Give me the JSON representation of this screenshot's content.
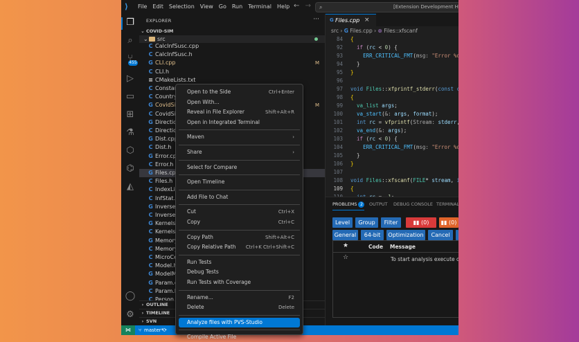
{
  "titlebar": {
    "menu": [
      "File",
      "Edit",
      "Selection",
      "View",
      "Go",
      "Run",
      "Terminal",
      "Help"
    ],
    "command_center": "[Extension Development Host] c"
  },
  "activity": {
    "badge": "455"
  },
  "explorer": {
    "title": "EXPLORER",
    "root": "COVID-SIM",
    "folder": "src",
    "files": [
      {
        "icon": "C",
        "cls": "c",
        "name": "CalcInfSusc.cpp",
        "status": "",
        "mod": false
      },
      {
        "icon": "C",
        "cls": "c",
        "name": "CalcInfSusc.h",
        "status": "",
        "mod": false
      },
      {
        "icon": "G",
        "cls": "cp",
        "name": "CLI.cpp",
        "status": "M",
        "mod": true
      },
      {
        "icon": "C",
        "cls": "c",
        "name": "CLI.h",
        "status": "",
        "mod": false
      },
      {
        "icon": "≡",
        "cls": "tx",
        "name": "CMakeLists.txt",
        "status": "",
        "mod": false
      },
      {
        "icon": "C",
        "cls": "c",
        "name": "Constant",
        "status": "",
        "mod": false
      },
      {
        "icon": "C",
        "cls": "c",
        "name": "Country.",
        "status": "",
        "mod": false
      },
      {
        "icon": "G",
        "cls": "cp",
        "name": "CovidSim",
        "status": "M",
        "mod": true
      },
      {
        "icon": "C",
        "cls": "c",
        "name": "CovidSim",
        "status": "",
        "mod": false
      },
      {
        "icon": "G",
        "cls": "cp",
        "name": "Direction",
        "status": "",
        "mod": false
      },
      {
        "icon": "C",
        "cls": "c",
        "name": "Direction",
        "status": "",
        "mod": false
      },
      {
        "icon": "G",
        "cls": "cp",
        "name": "Dist.cpp",
        "status": "",
        "mod": false
      },
      {
        "icon": "C",
        "cls": "c",
        "name": "Dist.h",
        "status": "",
        "mod": false
      },
      {
        "icon": "G",
        "cls": "cp",
        "name": "Error.cpp",
        "status": "",
        "mod": false
      },
      {
        "icon": "C",
        "cls": "c",
        "name": "Error.h",
        "status": "",
        "mod": false
      },
      {
        "icon": "G",
        "cls": "cp",
        "name": "Files.cpp",
        "status": "",
        "mod": false
      },
      {
        "icon": "C",
        "cls": "c",
        "name": "Files.h",
        "status": "",
        "mod": false
      },
      {
        "icon": "C",
        "cls": "c",
        "name": "IndexList",
        "status": "",
        "mod": false
      },
      {
        "icon": "C",
        "cls": "c",
        "name": "InfStat.h",
        "status": "",
        "mod": false
      },
      {
        "icon": "G",
        "cls": "cp",
        "name": "InverseC",
        "status": "",
        "mod": false
      },
      {
        "icon": "C",
        "cls": "c",
        "name": "InverseC",
        "status": "",
        "mod": false
      },
      {
        "icon": "G",
        "cls": "cp",
        "name": "Kernels.c",
        "status": "",
        "mod": false
      },
      {
        "icon": "C",
        "cls": "c",
        "name": "Kernels.h",
        "status": "",
        "mod": false
      },
      {
        "icon": "G",
        "cls": "cp",
        "name": "Memory.",
        "status": "",
        "mod": false
      },
      {
        "icon": "C",
        "cls": "c",
        "name": "Memory.",
        "status": "",
        "mod": false
      },
      {
        "icon": "C",
        "cls": "c",
        "name": "MicroCel",
        "status": "",
        "mod": false
      },
      {
        "icon": "C",
        "cls": "c",
        "name": "Model.h",
        "status": "",
        "mod": false
      },
      {
        "icon": "G",
        "cls": "cp",
        "name": "ModelM",
        "status": "",
        "mod": false
      },
      {
        "icon": "G",
        "cls": "cp",
        "name": "Param.cp",
        "status": "",
        "mod": false
      },
      {
        "icon": "C",
        "cls": "c",
        "name": "Param.h",
        "status": "",
        "mod": false
      },
      {
        "icon": "C",
        "cls": "c",
        "name": "Person.c",
        "status": "",
        "mod": false
      }
    ],
    "sections": [
      "OUTLINE",
      "TIMELINE",
      "SVN"
    ]
  },
  "editor": {
    "tab": "Files.cpp",
    "breadcrumb": [
      "src",
      "Files.cpp",
      "Files::xfscanf"
    ]
  },
  "panel": {
    "tabs": [
      "PROBLEMS",
      "OUTPUT",
      "DEBUG CONSOLE",
      "TERMINAL"
    ],
    "problems_count": "2",
    "buttons_row1": [
      "Level",
      "Group",
      "Filter"
    ],
    "count1": "(0)",
    "count2": "(0)",
    "buttons_row2": [
      "General",
      "64-bit",
      "Optimization",
      "Cancel"
    ],
    "table_headers": [
      "Code",
      "Message"
    ],
    "empty_message": "To start analysis execute one c"
  },
  "status": {
    "branch": "master*"
  },
  "context_menu": {
    "groups": [
      [
        {
          "label": "Open to the Side",
          "key": "Ctrl+Enter"
        },
        {
          "label": "Open With...",
          "key": ""
        },
        {
          "label": "Reveal in File Explorer",
          "key": "Shift+Alt+R"
        },
        {
          "label": "Open in Integrated Terminal",
          "key": ""
        }
      ],
      [
        {
          "label": "Maven",
          "key": "›"
        }
      ],
      [
        {
          "label": "Share",
          "key": "›"
        }
      ],
      [
        {
          "label": "Select for Compare",
          "key": ""
        }
      ],
      [
        {
          "label": "Open Timeline",
          "key": ""
        }
      ],
      [
        {
          "label": "Add File to Chat",
          "key": ""
        }
      ],
      [
        {
          "label": "Cut",
          "key": "Ctrl+X"
        },
        {
          "label": "Copy",
          "key": "Ctrl+C"
        }
      ],
      [
        {
          "label": "Copy Path",
          "key": "Shift+Alt+C"
        },
        {
          "label": "Copy Relative Path",
          "key": "Ctrl+K Ctrl+Shift+C"
        }
      ],
      [
        {
          "label": "Run Tests",
          "key": ""
        },
        {
          "label": "Debug Tests",
          "key": ""
        },
        {
          "label": "Run Tests with Coverage",
          "key": ""
        }
      ],
      [
        {
          "label": "Rename...",
          "key": "F2"
        },
        {
          "label": "Delete",
          "key": "Delete"
        }
      ],
      [
        {
          "label": "Analyze files with PVS-Studio",
          "key": ""
        }
      ],
      [
        {
          "label": "Compile Active File",
          "key": ""
        }
      ]
    ]
  }
}
